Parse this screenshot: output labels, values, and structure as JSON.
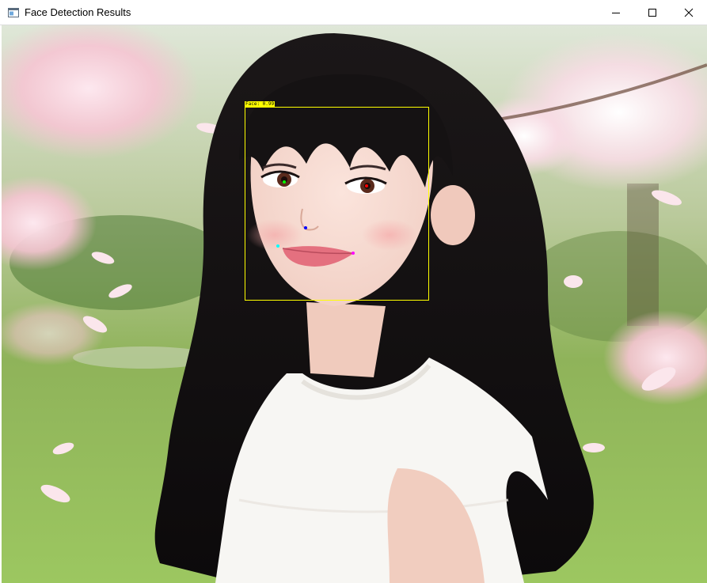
{
  "window": {
    "title": "Face Detection Results",
    "controls": [
      "minimize-icon",
      "maximize-icon",
      "close-icon"
    ]
  },
  "detection": {
    "label": "Face: 0.99",
    "box_color": "#ffff00",
    "landmarks": [
      {
        "name": "left-eye",
        "color": "#00ff00"
      },
      {
        "name": "right-eye",
        "color": "#ff0000"
      },
      {
        "name": "nose",
        "color": "#0000ff"
      },
      {
        "name": "mouth-left",
        "color": "#00ffff"
      },
      {
        "name": "mouth-right",
        "color": "#ff00ff"
      }
    ]
  }
}
